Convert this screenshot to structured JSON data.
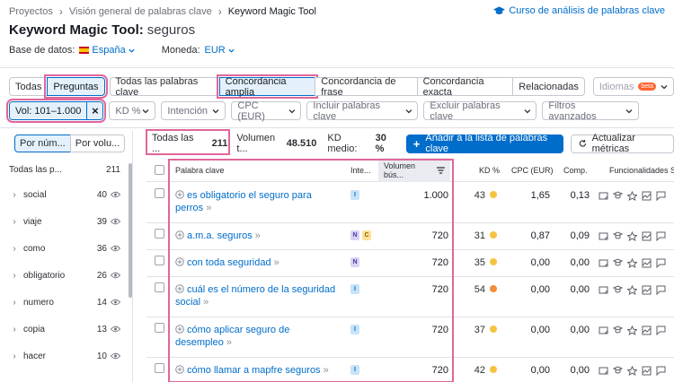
{
  "breadcrumb": {
    "items": [
      "Proyectos",
      "Visión general de palabras clave",
      "Keyword Magic Tool"
    ]
  },
  "course_link": "Curso de análisis de palabras clave",
  "title": {
    "tool": "Keyword Magic Tool:",
    "query": "seguros"
  },
  "database": {
    "label": "Base de datos:",
    "value": "España"
  },
  "currency": {
    "label": "Moneda:",
    "value": "EUR"
  },
  "match_tabs": {
    "group1": [
      "Todas",
      "Preguntas"
    ],
    "group2": [
      "Todas las palabras clave",
      "Concordancia amplia",
      "Concordancia de frase",
      "Concordancia exacta",
      "Relacionadas"
    ],
    "selected": [
      "Preguntas",
      "Concordancia amplia"
    ],
    "languages": "Idiomas",
    "beta": "beta"
  },
  "filters": {
    "volume": "Vol: 101–1.000",
    "dropdowns": [
      "KD %",
      "Intención",
      "CPC (EUR)",
      "Incluir palabras clave",
      "Excluir palabras clave",
      "Filtros avanzados"
    ]
  },
  "sidebar": {
    "toggle": [
      "Por núm...",
      "Por volu..."
    ],
    "all_label": "Todas las p...",
    "all_count": "211",
    "groups": [
      {
        "name": "social",
        "count": "40"
      },
      {
        "name": "viaje",
        "count": "39"
      },
      {
        "name": "como",
        "count": "36"
      },
      {
        "name": "obligatorio",
        "count": "26"
      },
      {
        "name": "numero",
        "count": "14"
      },
      {
        "name": "copia",
        "count": "13"
      },
      {
        "name": "hacer",
        "count": "10"
      }
    ]
  },
  "summary": {
    "all_label": "Todas las ...",
    "all_count": "211",
    "volume_label": "Volumen t...",
    "volume_value": "48.510",
    "kd_label": "KD medio:",
    "kd_value": "30 %",
    "add_button": "Añadir a la lista de palabras clave",
    "update_button": "Actualizar métricas"
  },
  "columns": {
    "keyword": "Palabra clave",
    "intent": "Inte...",
    "volume": "Volumen bús...",
    "kd": "KD %",
    "cpc": "CPC (EUR)",
    "comp": "Comp.",
    "features": "Funcionalidades SE"
  },
  "rows": [
    {
      "keyword": "es obligatorio el seguro para perros",
      "intents": [
        "I"
      ],
      "volume": "1.000",
      "kd": "43",
      "kd_color": "#f5c342",
      "cpc": "1,65",
      "comp": "0,13"
    },
    {
      "keyword": "a.m.a. seguros",
      "intents": [
        "N",
        "C"
      ],
      "volume": "720",
      "kd": "31",
      "kd_color": "#f5c342",
      "cpc": "0,87",
      "comp": "0,09"
    },
    {
      "keyword": "con toda seguridad",
      "intents": [
        "N"
      ],
      "volume": "720",
      "kd": "35",
      "kd_color": "#f5c342",
      "cpc": "0,00",
      "comp": "0,00"
    },
    {
      "keyword": "cuál es el número de la seguridad social",
      "intents": [
        "I"
      ],
      "volume": "720",
      "kd": "54",
      "kd_color": "#f18d3b",
      "cpc": "0,00",
      "comp": "0,00"
    },
    {
      "keyword": "cómo aplicar seguro de desempleo",
      "intents": [
        "I"
      ],
      "volume": "720",
      "kd": "37",
      "kd_color": "#f5c342",
      "cpc": "0,00",
      "comp": "0,00"
    },
    {
      "keyword": "cómo llamar a mapfre seguros",
      "intents": [
        "I"
      ],
      "volume": "720",
      "kd": "42",
      "kd_color": "#f5c342",
      "cpc": "0,00",
      "comp": "0,00"
    }
  ],
  "colors": {
    "accent": "#006dca",
    "highlight": "#e0669a",
    "selected_bg": "#e4f1fc"
  }
}
